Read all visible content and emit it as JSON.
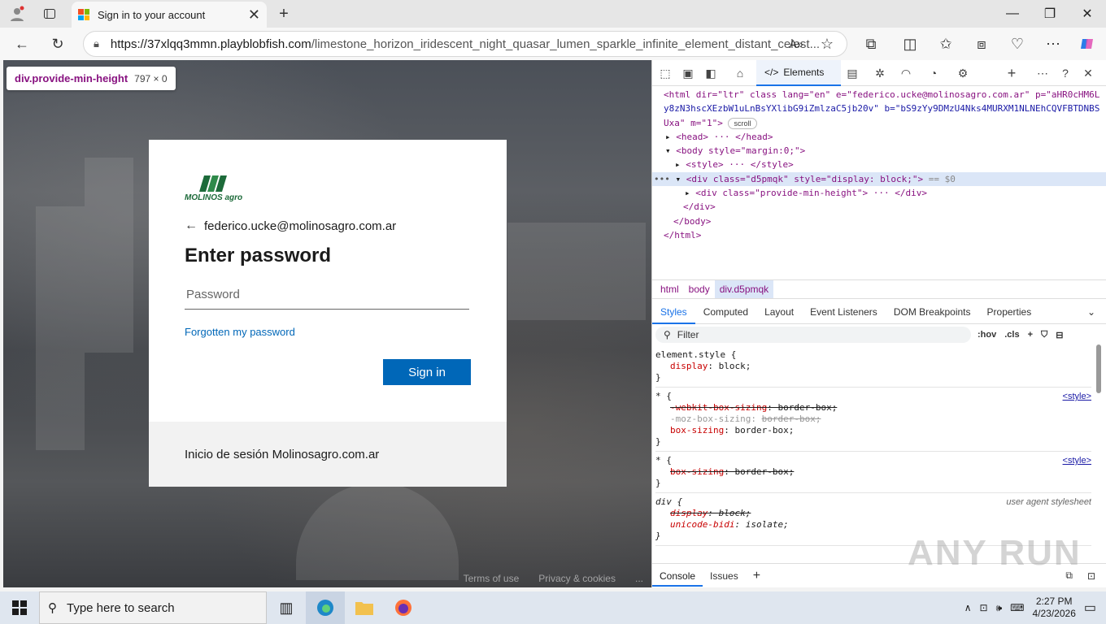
{
  "browser": {
    "tab_title": "Sign in to your account",
    "url_host": "https://37xlqq3mmn.playblobfish.com",
    "url_path": "/limestone_horizon_iridescent_night_quasar_lumen_sparkle_infinite_element_distant_celest..."
  },
  "page": {
    "tooltip_selector": "div.provide-min-height",
    "tooltip_size": "797 × 0",
    "logo_text": "MOLINOS agro",
    "email": "federico.ucke@molinosagro.com.ar",
    "heading": "Enter password",
    "password_placeholder": "Password",
    "forgot_link": "Forgotten my password",
    "signin_button": "Sign in",
    "footer_text": "Inicio de sesión Molinosagro.com.ar",
    "footer_link_terms": "Terms of use",
    "footer_link_privacy": "Privacy & cookies",
    "footer_more": "..."
  },
  "devtools": {
    "elements_tab": "Elements",
    "dom": {
      "html_open_1": "<html dir=\"ltr\" class lang=\"en\" e=\"federico.ucke@molinosagro.com.ar\" p=\"aHR0cHM6L",
      "html_open_2": "y8zN3hscXEzbW1uLnBsYXlibG9iZmlzaC5jb20v\" b=\"bS9zYy9DMzU4Nks4MURXM1NLNEhCQVFBTDNBS",
      "html_open_3": "Uxa\" m=\"1\">",
      "scroll_badge": "scroll",
      "head_line": "<head> ··· </head>",
      "body_open": "<body style=\"margin:0;\">",
      "style_line": "<style> ··· </style>",
      "div_d5_line": "<div class=\"d5pmqk\" style=\"display: block;\">",
      "dollar0": "== $0",
      "div_provide_line": "<div class=\"provide-min-height\"> ··· </div>",
      "div_close": "</div>",
      "body_close": "</body>",
      "html_close": "</html>"
    },
    "breadcrumbs": [
      "html",
      "body",
      "div.d5pmqk"
    ],
    "subtabs": [
      "Styles",
      "Computed",
      "Layout",
      "Event Listeners",
      "DOM Breakpoints",
      "Properties"
    ],
    "filter_placeholder": "Filter",
    "filter_tools": [
      ":hov",
      ".cls"
    ],
    "rules": {
      "r1_selector": "element.style {",
      "r1_prop": "display",
      "r1_val": "block;",
      "r2_selector": "* {",
      "r2_src": "<style>",
      "r2_d1_prop": "-webkit-box-sizing",
      "r2_d1_val": "border-box;",
      "r2_d2_prop": "-moz-box-sizing",
      "r2_d2_val": "border-box;",
      "r2_d3_prop": "box-sizing",
      "r2_d3_val": "border-box;",
      "r3_selector": "* {",
      "r3_src": "<style>",
      "r3_d1_prop": "box-sizing",
      "r3_d1_val": "border-box;",
      "r4_selector": "div {",
      "r4_src": "user agent stylesheet",
      "r4_d1_prop": "display",
      "r4_d1_val": "block;",
      "r4_d2_prop": "unicode-bidi",
      "r4_d2_val": "isolate;",
      "close_brace": "}"
    },
    "bottom_tabs": [
      "Console",
      "Issues"
    ]
  },
  "watermark": "ANY RUN",
  "taskbar": {
    "search_placeholder": "Type here to search",
    "time": "2:27 PM",
    "date": "4/23/2026"
  },
  "colors": {
    "signin_blue": "#0067b8",
    "devtools_accent": "#1a73e8",
    "brand_green": "#1d6b3a"
  }
}
